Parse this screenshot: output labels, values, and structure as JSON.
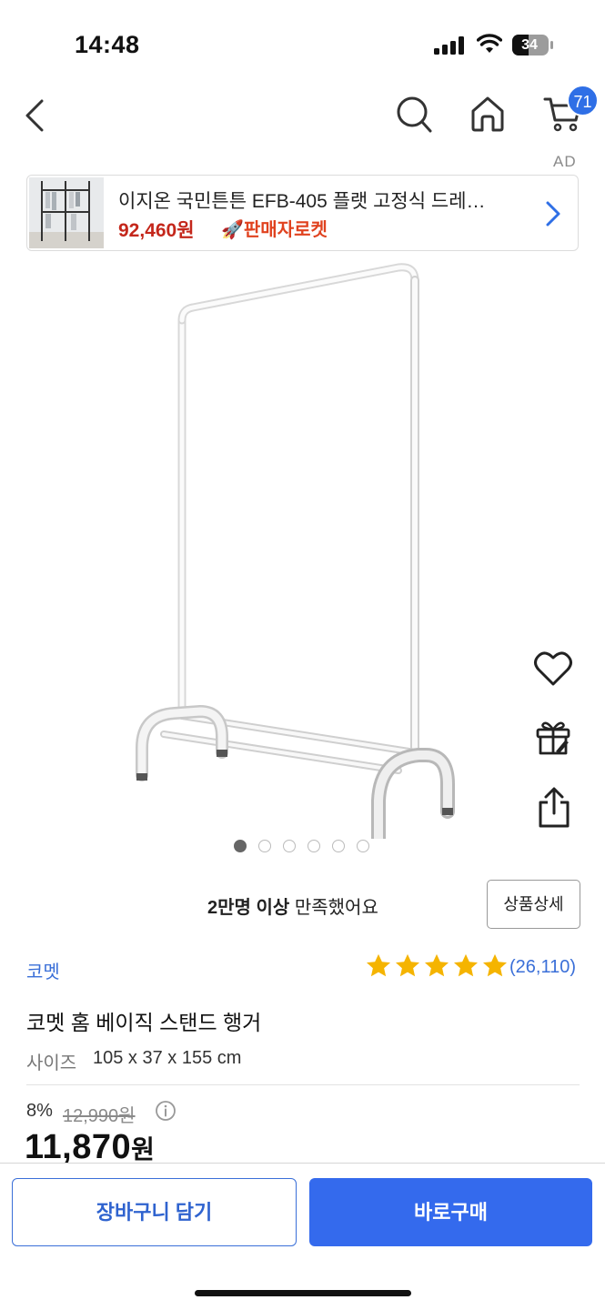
{
  "status_bar": {
    "time": "14:48",
    "battery": "34"
  },
  "header": {
    "cart_count": "71"
  },
  "ad": {
    "label": "AD",
    "title": "이지온 국민튼튼 EFB-405 플랫 고정식 드레…",
    "price": "92,460원",
    "badge": "🚀판매자로켓"
  },
  "gallery": {
    "dots": 6,
    "active_index": 0
  },
  "satisfaction": {
    "bold": "2만명 이상",
    "rest": " 만족했어요"
  },
  "detail_button": "상품상세",
  "product": {
    "brand": "코멧",
    "rating": 5,
    "review_count": "(26,110)",
    "title": "코멧 홈 베이직 스탠드 행거",
    "size_label": "사이즈",
    "size_value": "105 x 37 x 155 cm",
    "discount": "8%",
    "original_price": "12,990원",
    "final_price": "11,870",
    "final_price_unit": "원"
  },
  "actions": {
    "add_to_cart": "장바구니 담기",
    "buy_now": "바로구매"
  },
  "colors": {
    "accent_blue": "#346aed",
    "link_blue": "#3a6fd8",
    "ad_price_red": "#c4271b",
    "star_yellow": "#f5b400"
  }
}
